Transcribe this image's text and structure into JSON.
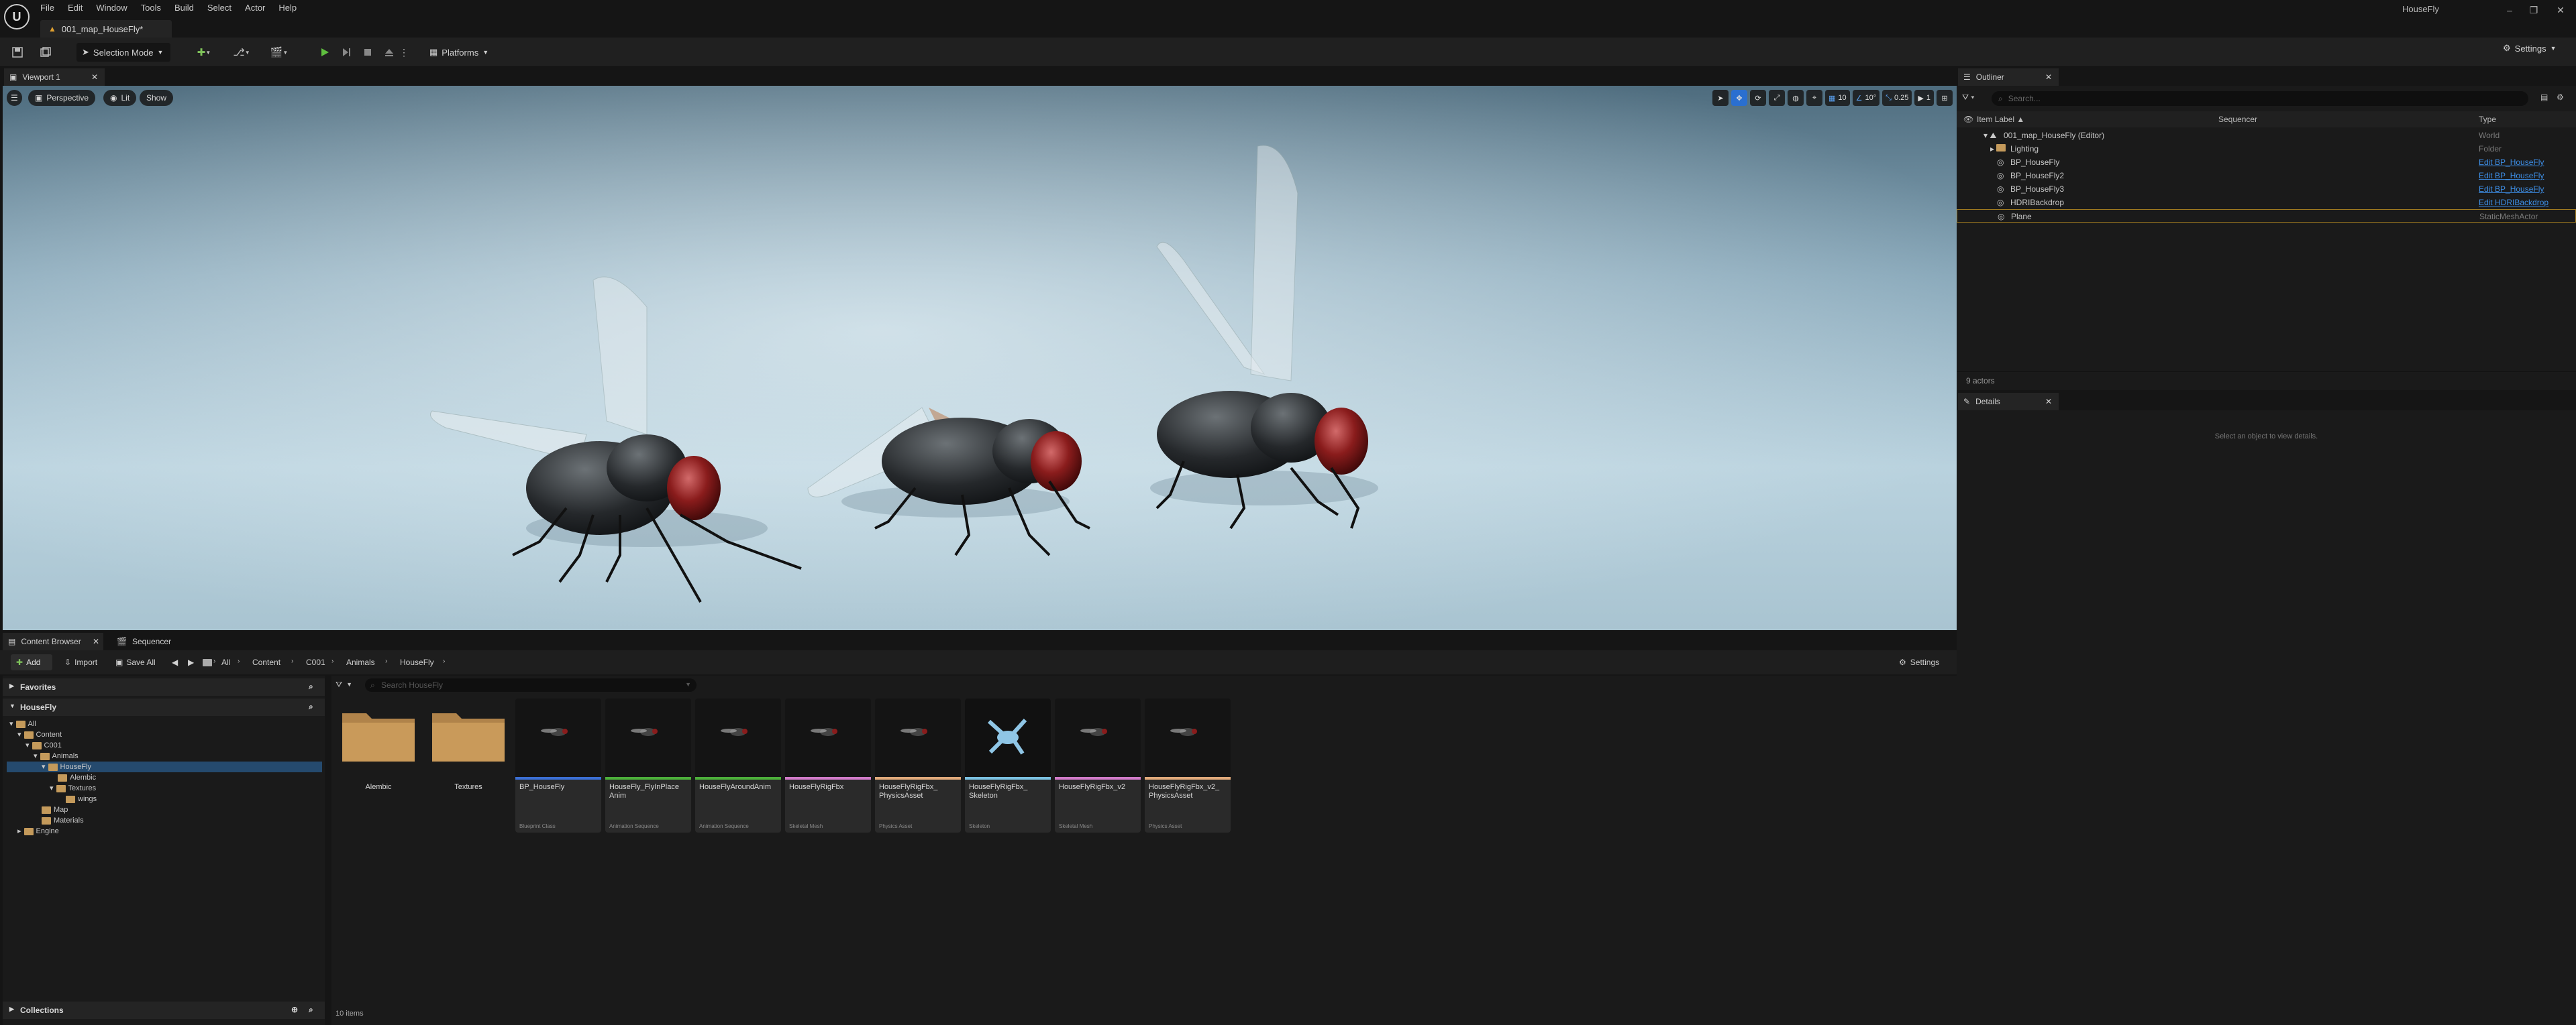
{
  "window": {
    "project_name": "HouseFly"
  },
  "menu": [
    "File",
    "Edit",
    "Window",
    "Tools",
    "Build",
    "Select",
    "Actor",
    "Help"
  ],
  "map_tab": {
    "label": "001_map_HouseFly*"
  },
  "toolbar": {
    "selection_mode": "Selection Mode",
    "platforms": "Platforms",
    "settings": "Settings"
  },
  "viewport": {
    "tab_label": "Viewport 1",
    "perspective": "Perspective",
    "lit": "Lit",
    "show": "Show",
    "grid_snap": "10",
    "rot_snap": "10°",
    "scale_snap": "0.25",
    "camera_speed": "1"
  },
  "outliner": {
    "tab_label": "Outliner",
    "search_placeholder": "Search...",
    "columns": {
      "label": "Item Label ▲",
      "sequencer": "Sequencer",
      "type": "Type"
    },
    "rows": [
      {
        "label": "001_map_HouseFly (Editor)",
        "type": "World",
        "link": false
      },
      {
        "label": "Lighting",
        "type": "Folder",
        "link": false
      },
      {
        "label": "BP_HouseFly",
        "type": "Edit BP_HouseFly",
        "link": true
      },
      {
        "label": "BP_HouseFly2",
        "type": "Edit BP_HouseFly",
        "link": true
      },
      {
        "label": "BP_HouseFly3",
        "type": "Edit BP_HouseFly",
        "link": true
      },
      {
        "label": "HDRIBackdrop",
        "type": "Edit HDRIBackdrop",
        "link": true
      },
      {
        "label": "Plane",
        "type": "StaticMeshActor",
        "link": false
      }
    ],
    "footer": "9 actors"
  },
  "details": {
    "tab_label": "Details",
    "empty_text": "Select an object to view details."
  },
  "content_browser": {
    "tab_label": "Content Browser",
    "sequencer_tab": "Sequencer",
    "add": "Add",
    "import": "Import",
    "save_all": "Save All",
    "settings": "Settings",
    "breadcrumb": [
      "All",
      "Content",
      "C001",
      "Animals",
      "HouseFly"
    ],
    "favorites": "Favorites",
    "root": "HouseFly",
    "tree": [
      "All",
      "Content",
      "C001",
      "Animals",
      "HouseFly",
      "Alembic",
      "Textures",
      "wings",
      "Map",
      "Materials",
      "Engine"
    ],
    "search_placeholder": "Search HouseFly",
    "collections": "Collections",
    "item_count": "10 items",
    "folders": [
      "Alembic",
      "Textures"
    ],
    "assets": [
      {
        "name": "BP_HouseFly",
        "type": "Blueprint Class",
        "color": "#3b6fd4"
      },
      {
        "name": "HouseFly_FlyInPlace Anim",
        "type": "Animation Sequence",
        "color": "#4caf3a"
      },
      {
        "name": "HouseFlyAroundAnim",
        "type": "Animation Sequence",
        "color": "#4caf3a"
      },
      {
        "name": "HouseFlyRigFbx",
        "type": "Skeletal Mesh",
        "color": "#d07ac8"
      },
      {
        "name": "HouseFlyRigFbx_ PhysicsAsset",
        "type": "Physics Asset",
        "color": "#e0a97a"
      },
      {
        "name": "HouseFlyRigFbx_ Skeleton",
        "type": "Skeleton",
        "color": "#7ac0e0"
      },
      {
        "name": "HouseFlyRigFbx_v2",
        "type": "Skeletal Mesh",
        "color": "#d07ac8"
      },
      {
        "name": "HouseFlyRigFbx_v2_ PhysicsAsset",
        "type": "Physics Asset",
        "color": "#e0a97a"
      }
    ]
  }
}
